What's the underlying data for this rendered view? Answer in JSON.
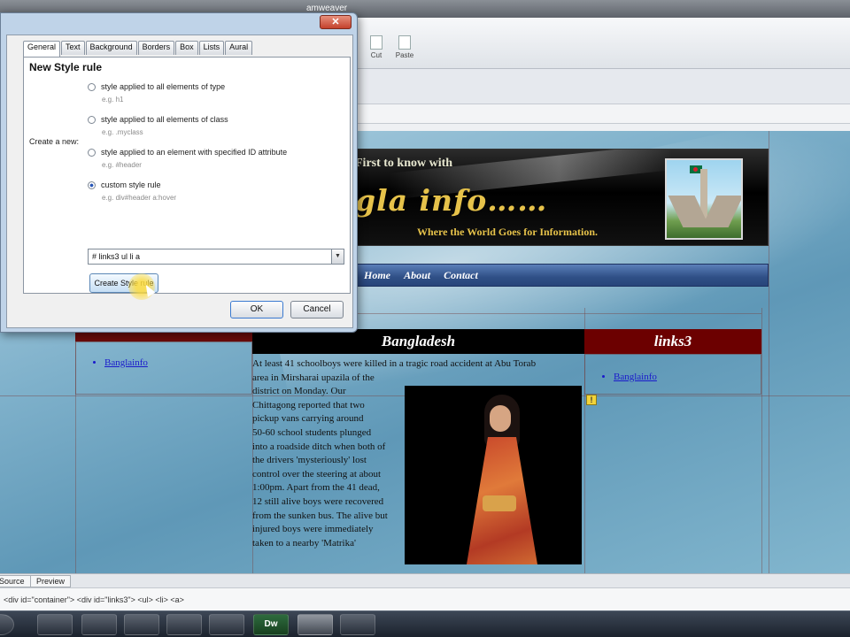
{
  "app": {
    "title": "amweaver"
  },
  "toolbar": {
    "cut_label": "Cut",
    "paste_label": "Paste"
  },
  "page": {
    "banner": {
      "tagline": "First to know with",
      "title": "gla info……",
      "slogan": "Where the World Goes for Information."
    },
    "nav": [
      "Home",
      "About",
      "Contact"
    ],
    "left_links": [
      "Banglainfo"
    ],
    "middle_heading": "Bangladesh",
    "right_heading": "links3",
    "right_links": [
      "Banglainfo"
    ],
    "article_lines_wide": [
      "At least 41 schoolboys were killed in a tragic road accident at Abu Torab",
      "area in Mirsharai upazila of the"
    ],
    "article_lines": [
      "district on Monday. Our",
      "Chittagong reported that two",
      "pickup vans carrying around",
      "50-60 school students plunged",
      "into a roadside ditch when both of",
      "the drivers 'mysteriously' lost",
      "control over the steering at about",
      "1:00pm. Apart from the 41 dead,",
      "12 still alive boys were recovered",
      "from the sunken bus. The alive but",
      "injured boys were immediately",
      "taken to a nearby 'Matrika'"
    ],
    "notice_icon": "!"
  },
  "view_tabs": [
    "Source",
    "Preview"
  ],
  "tag_selector": "<div id=\"container\"> <div id=\"links3\"> <ul> <li> <a>",
  "taskbar_items": [
    {
      "icon": "start-orb",
      "label": ""
    },
    {
      "icon": "hp-icon",
      "label": ""
    },
    {
      "icon": "mail-icon",
      "label": ""
    },
    {
      "icon": "firefox-icon",
      "label": ""
    },
    {
      "icon": "chrome-icon",
      "label": ""
    },
    {
      "icon": "media-icon",
      "label": ""
    },
    {
      "icon": "dreamweaver-icon",
      "label": "Dw"
    },
    {
      "icon": "folder-icon",
      "label": ""
    },
    {
      "icon": "media-icon",
      "label": ""
    }
  ],
  "dialog": {
    "close": "✕",
    "tabs": [
      "General",
      "Text",
      "Background",
      "Borders",
      "Box",
      "Lists",
      "Aural"
    ],
    "active_tab": "General",
    "heading": "New Style rule",
    "create_label": "Create a new:",
    "options": [
      {
        "label": "style applied to all elements of type",
        "example": "e.g. h1",
        "selected": false
      },
      {
        "label": "style applied to all elements of class",
        "example": "e.g. .myclass",
        "selected": false
      },
      {
        "label": "style applied to an element with specified ID attribute",
        "example": "e.g. #header",
        "selected": false
      },
      {
        "label": "custom style rule",
        "example": "e.g. div#header a:hover",
        "selected": true
      }
    ],
    "selector_value": "# links3 ul li a",
    "create_button": "Create Style rule",
    "ok_button": "OK",
    "cancel_button": "Cancel"
  },
  "colors": {
    "banner_gold": "#e6c24a",
    "nav_blue": "#2f4f86",
    "header_maroon": "#6c0000",
    "link_blue": "#1a1acb"
  }
}
